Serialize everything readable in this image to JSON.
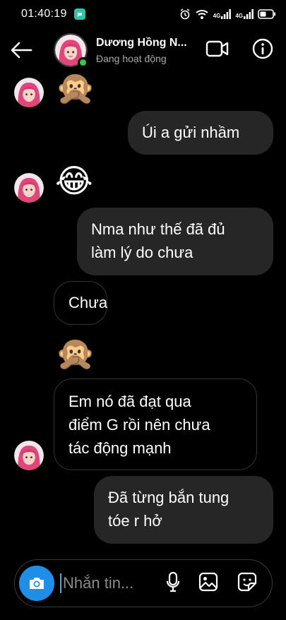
{
  "status": {
    "time": "01:40:19",
    "network_1": "4G",
    "network_2": "4G"
  },
  "header": {
    "name": "Dương Hồng N...",
    "subtitle": "Đang hoạt động"
  },
  "messages": [
    {
      "from": "them",
      "type": "emoji",
      "content": "🙊"
    },
    {
      "from": "me",
      "type": "text",
      "lines": [
        "Úi a gửi nhầm"
      ]
    },
    {
      "from": "them",
      "type": "emoji",
      "content": "😂"
    },
    {
      "from": "me",
      "type": "text",
      "lines": [
        "Nma như thế đã đủ",
        "làm lý do chưa"
      ]
    },
    {
      "from": "them",
      "type": "text",
      "lines": [
        "Chưa"
      ]
    },
    {
      "from": "them",
      "type": "emoji",
      "content": "🙊"
    },
    {
      "from": "them",
      "type": "text",
      "lines": [
        "Em nó đã đạt qua",
        "điểm G rồi nên chưa",
        "tác động mạnh"
      ]
    },
    {
      "from": "me",
      "type": "text",
      "lines": [
        "Đã từng bắn tung",
        "tóe r hở"
      ]
    }
  ],
  "composer": {
    "placeholder": "Nhắn tin..."
  },
  "colors": {
    "background": "#000000",
    "sent_bubble": "#262626",
    "online": "#3cc743",
    "camera_button": "#1e8ee6"
  },
  "icons": [
    "back-arrow-icon",
    "video-call-icon",
    "info-icon",
    "camera-icon",
    "microphone-icon",
    "gallery-icon",
    "sticker-icon"
  ]
}
